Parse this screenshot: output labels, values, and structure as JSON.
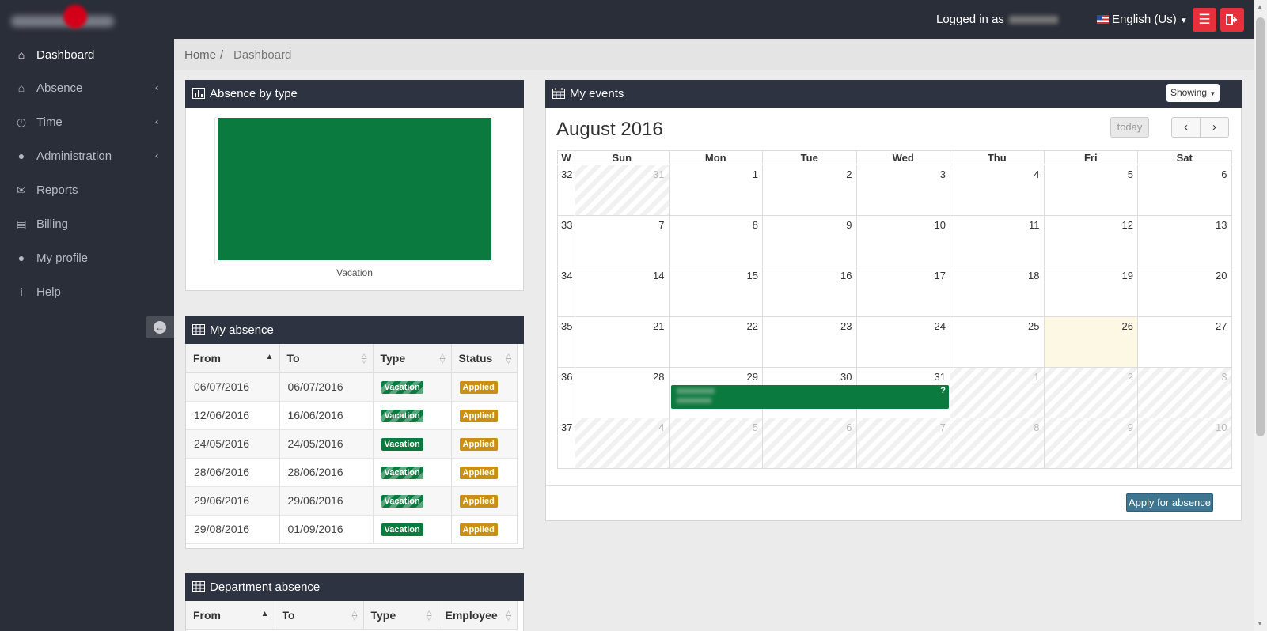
{
  "header": {
    "logged_in_prefix": "Logged in as",
    "language": "English (Us)",
    "menu_icon": "hamburger-icon",
    "logout_icon": "sign-out-icon"
  },
  "sidebar": {
    "items": [
      {
        "label": "Dashboard",
        "icon": "home-icon",
        "active": true
      },
      {
        "label": "Absence",
        "icon": "home-icon",
        "has_submenu": true
      },
      {
        "label": "Time",
        "icon": "clock-icon",
        "has_submenu": true
      },
      {
        "label": "Administration",
        "icon": "user-icon",
        "has_submenu": true
      },
      {
        "label": "Reports",
        "icon": "envelope-icon"
      },
      {
        "label": "Billing",
        "icon": "credit-card-icon"
      },
      {
        "label": "My profile",
        "icon": "user-icon"
      },
      {
        "label": "Help",
        "icon": "info-icon"
      }
    ]
  },
  "breadcrumb": {
    "home": "Home",
    "separator": "/",
    "current": "Dashboard"
  },
  "absence_by_type": {
    "title": "Absence by type",
    "chart_data": {
      "type": "bar",
      "categories": [
        "Vacation"
      ],
      "values": [
        1
      ],
      "colors": [
        "#0b7a3e"
      ]
    }
  },
  "my_absence": {
    "title": "My absence",
    "columns": [
      "From",
      "To",
      "Type",
      "Status"
    ],
    "rows": [
      {
        "from": "06/07/2016",
        "to": "06/07/2016",
        "type": "Vacation",
        "status": "Applied"
      },
      {
        "from": "12/06/2016",
        "to": "16/06/2016",
        "type": "Vacation",
        "status": "Applied"
      },
      {
        "from": "24/05/2016",
        "to": "24/05/2016",
        "type": "Vacation",
        "status": "Applied"
      },
      {
        "from": "28/06/2016",
        "to": "28/06/2016",
        "type": "Vacation",
        "status": "Applied"
      },
      {
        "from": "29/06/2016",
        "to": "29/06/2016",
        "type": "Vacation",
        "status": "Applied"
      },
      {
        "from": "29/08/2016",
        "to": "01/09/2016",
        "type": "Vacation",
        "status": "Applied"
      }
    ]
  },
  "department_absence": {
    "title": "Department absence",
    "columns": [
      "From",
      "To",
      "Type",
      "Employee"
    ]
  },
  "my_events": {
    "title": "My events",
    "showing_label": "Showing",
    "month_title": "August 2016",
    "today_label": "today",
    "prev_label": "‹",
    "next_label": "›",
    "week_header": "W",
    "day_headers": [
      "Sun",
      "Mon",
      "Tue",
      "Wed",
      "Thu",
      "Fri",
      "Sat"
    ],
    "weeks": [
      {
        "num": "32",
        "days": [
          "31",
          "1",
          "2",
          "3",
          "4",
          "5",
          "6"
        ],
        "other": [
          true,
          false,
          false,
          false,
          false,
          false,
          false
        ]
      },
      {
        "num": "33",
        "days": [
          "7",
          "8",
          "9",
          "10",
          "11",
          "12",
          "13"
        ],
        "other": [
          false,
          false,
          false,
          false,
          false,
          false,
          false
        ]
      },
      {
        "num": "34",
        "days": [
          "14",
          "15",
          "16",
          "17",
          "18",
          "19",
          "20"
        ],
        "other": [
          false,
          false,
          false,
          false,
          false,
          false,
          false
        ]
      },
      {
        "num": "35",
        "days": [
          "21",
          "22",
          "23",
          "24",
          "25",
          "26",
          "27"
        ],
        "other": [
          false,
          false,
          false,
          false,
          false,
          false,
          false
        ]
      },
      {
        "num": "36",
        "days": [
          "28",
          "29",
          "30",
          "31",
          "1",
          "2",
          "3"
        ],
        "other": [
          false,
          false,
          false,
          false,
          true,
          true,
          true
        ]
      },
      {
        "num": "37",
        "days": [
          "4",
          "5",
          "6",
          "7",
          "8",
          "9",
          "10"
        ],
        "other": [
          true,
          true,
          true,
          true,
          true,
          true,
          true
        ]
      }
    ],
    "today": {
      "week": 3,
      "day": 5
    },
    "event": {
      "marker": "?",
      "color": "#0b7a3e"
    },
    "apply_label": "Apply for absence"
  },
  "colors": {
    "topbar": "#2a2e38",
    "panel_header": "#2e3342",
    "vacation": "#0b7a3e",
    "applied": "#c99015",
    "danger": "#e8303c",
    "apply_button": "#3e7590"
  }
}
